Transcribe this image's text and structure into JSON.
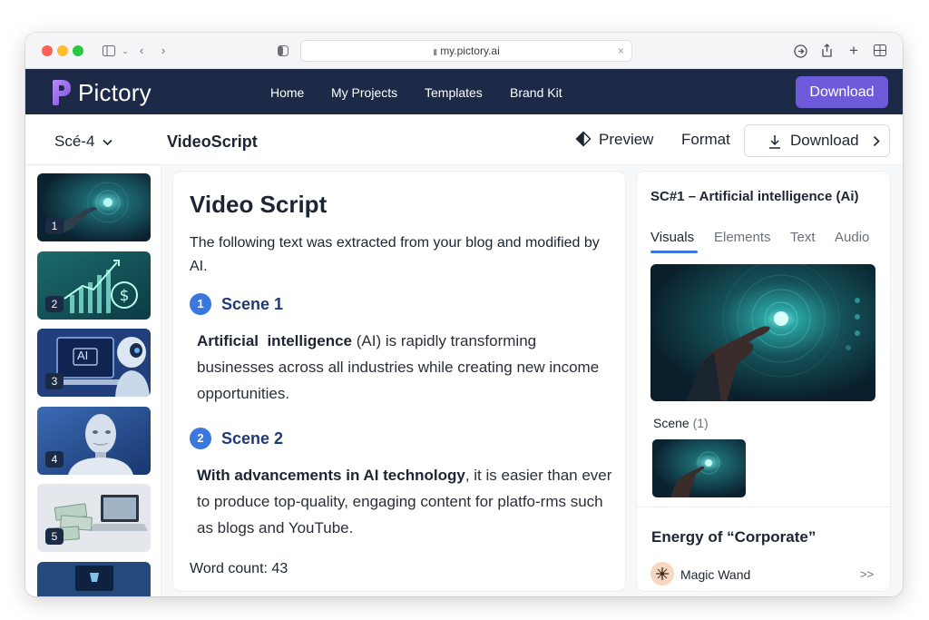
{
  "browser": {
    "url": "my.pictory.ai"
  },
  "navbar": {
    "logo_text": "Pictory",
    "links": [
      "Home",
      "My Projects",
      "Templates",
      "Brand Kit"
    ],
    "download_label": "Download"
  },
  "toolbar": {
    "scene_select": "Scé-4",
    "title": "VideoScript",
    "preview_label": "Preview",
    "format_label": "Format",
    "download_label": "Download"
  },
  "thumbnails": [
    "1",
    "2",
    "3",
    "4",
    "5"
  ],
  "thumbnail_3_badge": "AI",
  "script": {
    "title": "Video Script",
    "intro": "The following text was extracted from your blog and modified by AI.",
    "scenes": [
      {
        "number": "1",
        "heading": "Scene 1",
        "bold": "Artificial  intelligence",
        "text": " (AI) is rapidly transforming businesses across all industries while creating new income opportunities."
      },
      {
        "number": "2",
        "heading": "Scene 2",
        "bold": "With advancements in AI technology",
        "text": ", it is easier than ever to produce top-quality, engaging content for platfo-rms such as blogs and YouTube."
      }
    ],
    "word_count": "Word count: 43"
  },
  "right_panel": {
    "title": "SC#1 – Artificial intelligence (Ai)",
    "tabs": [
      "Visuals",
      "Elements",
      "Text",
      "Audio"
    ],
    "active_tab": "Visuals",
    "scene_label": "Scene",
    "scene_count": "(1)",
    "energy_label": "Energy of “Corporate”",
    "wand_label": "Magic Wand",
    "more_label": ">>"
  },
  "colors": {
    "navbar_bg": "#1c2a47",
    "accent_purple": "#6e5bd9",
    "accent_blue": "#3a78e0"
  }
}
